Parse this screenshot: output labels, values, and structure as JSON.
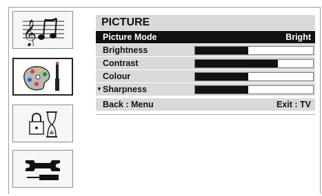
{
  "sidebar": {
    "items": [
      {
        "icon": "music-icon",
        "active": false
      },
      {
        "icon": "palette-icon",
        "active": true
      },
      {
        "icon": "lock-timer-icon",
        "active": false
      },
      {
        "icon": "tools-icon",
        "active": false
      }
    ]
  },
  "menu": {
    "title": "PICTURE",
    "rows": [
      {
        "label": "Picture Mode",
        "value": "Bright"
      },
      {
        "label": "Brightness",
        "level": 0.45
      },
      {
        "label": "Contrast",
        "level": 0.7
      },
      {
        "label": "Colour",
        "level": 0.45
      },
      {
        "label": "Sharpness",
        "level": 0.45
      }
    ],
    "footer_left": "Back : Menu",
    "footer_right": "Exit : TV"
  }
}
